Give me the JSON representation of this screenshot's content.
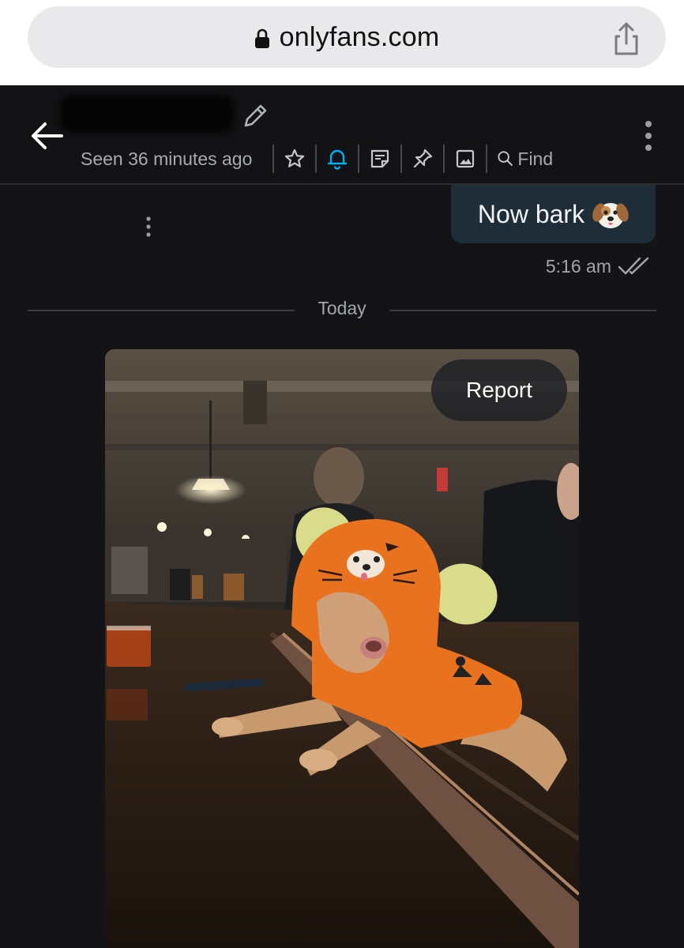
{
  "browser": {
    "url": "onlyfans.com",
    "icons": {
      "lock": "lock-icon",
      "share": "share-icon"
    }
  },
  "chat_header": {
    "back_icon": "back-arrow-icon",
    "edit_icon": "pencil-icon",
    "menu_icon": "more-vertical-icon",
    "seen_status": "Seen 36 minutes ago",
    "tools": [
      "star-icon",
      "bell-icon",
      "note-icon",
      "pin-icon",
      "image-icon"
    ],
    "find_label": "Find",
    "accent_color": "#00aff0"
  },
  "messages": {
    "outgoing": {
      "text": "Now bark",
      "emoji_icon": "dog-face-icon",
      "time": "5:16 am",
      "status_icon": "double-check-icon"
    },
    "date_divider": "Today",
    "photo_message": {
      "report_label": "Report",
      "image_content": "photo"
    }
  }
}
